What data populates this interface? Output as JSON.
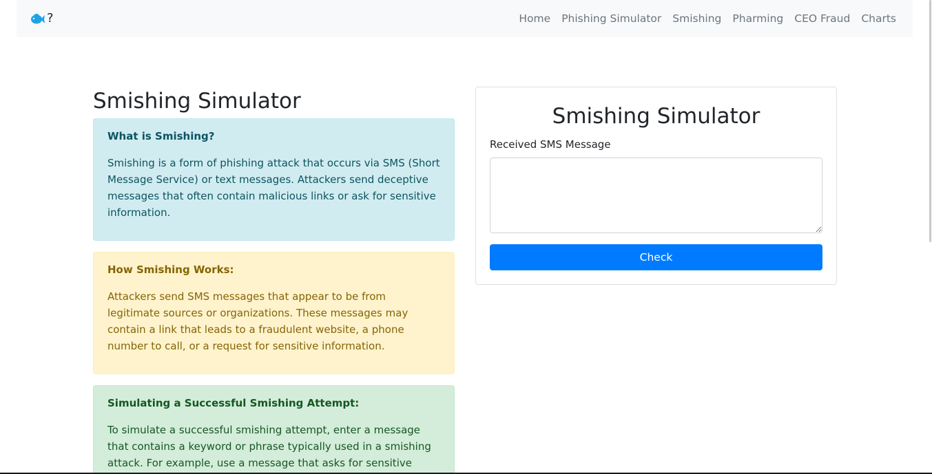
{
  "navbar": {
    "brand_icon": "fish-icon",
    "brand_text": "?",
    "links": [
      {
        "label": "Home"
      },
      {
        "label": "Phishing Simulator"
      },
      {
        "label": "Smishing"
      },
      {
        "label": "Pharming"
      },
      {
        "label": "CEO Fraud"
      },
      {
        "label": "Charts"
      }
    ]
  },
  "page": {
    "title": "Smishing Simulator"
  },
  "info_boxes": [
    {
      "heading": "What is Smishing?",
      "body": "Smishing is a form of phishing attack that occurs via SMS (Short Message Service) or text messages. Attackers send deceptive messages that often contain malicious links or ask for sensitive information."
    },
    {
      "heading": "How Smishing Works:",
      "body": "Attackers send SMS messages that appear to be from legitimate sources or organizations. These messages may contain a link that leads to a fraudulent website, a phone number to call, or a request for sensitive information."
    },
    {
      "heading": "Simulating a Successful Smishing Attempt:",
      "body": "To simulate a successful smishing attempt, enter a message that contains a keyword or phrase typically used in a smishing attack. For example, use a message that asks for sensitive information like"
    }
  ],
  "simulator": {
    "title": "Smishing Simulator",
    "sms_label": "Received SMS Message",
    "sms_value": "",
    "check_label": "Check"
  },
  "colors": {
    "primary": "#007bff",
    "info_bg": "#d1ecf1",
    "warning_bg": "#fff3cd",
    "success_bg": "#d4edda",
    "brand_icon": "#1fa3e8"
  }
}
